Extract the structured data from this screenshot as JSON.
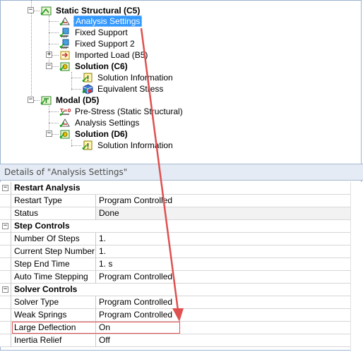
{
  "tree": {
    "static_structural": "Static Structural (C5)",
    "analysis_settings": "Analysis Settings",
    "fixed_support": "Fixed Support",
    "fixed_support_2": "Fixed Support 2",
    "imported_load": "Imported Load (B5)",
    "solution_c6": "Solution (C6)",
    "solution_information": "Solution Information",
    "equivalent_stress": "Equivalent Stress",
    "modal": "Modal (D5)",
    "pre_stress": "Pre-Stress (Static Structural)",
    "analysis_settings_2": "Analysis Settings",
    "solution_d6": "Solution (D6)",
    "solution_information_2": "Solution Information",
    "expander_minus": "−",
    "expander_plus": "+"
  },
  "details": {
    "title": "Details of \"Analysis Settings\"",
    "groups": {
      "restart": "Restart Analysis",
      "step": "Step Controls",
      "solver": "Solver Controls"
    },
    "rows": {
      "restart_type": {
        "label": "Restart Type",
        "value": "Program Controlled"
      },
      "status": {
        "label": "Status",
        "value": "Done"
      },
      "num_steps": {
        "label": "Number Of Steps",
        "value": "1."
      },
      "current_step": {
        "label": "Current Step Number",
        "value": "1."
      },
      "step_end_time": {
        "label": "Step End Time",
        "value": "1. s"
      },
      "auto_time": {
        "label": "Auto Time Stepping",
        "value": "Program Controlled"
      },
      "solver_type": {
        "label": "Solver Type",
        "value": "Program Controlled"
      },
      "weak_springs": {
        "label": "Weak Springs",
        "value": "Program Controlled"
      },
      "large_deflection": {
        "label": "Large Deflection",
        "value": "On"
      },
      "inertia_relief": {
        "label": "Inertia Relief",
        "value": "Off"
      }
    }
  },
  "colors": {
    "selection": "#3399ff",
    "annotation": "#e05050",
    "check": "#19a319"
  }
}
